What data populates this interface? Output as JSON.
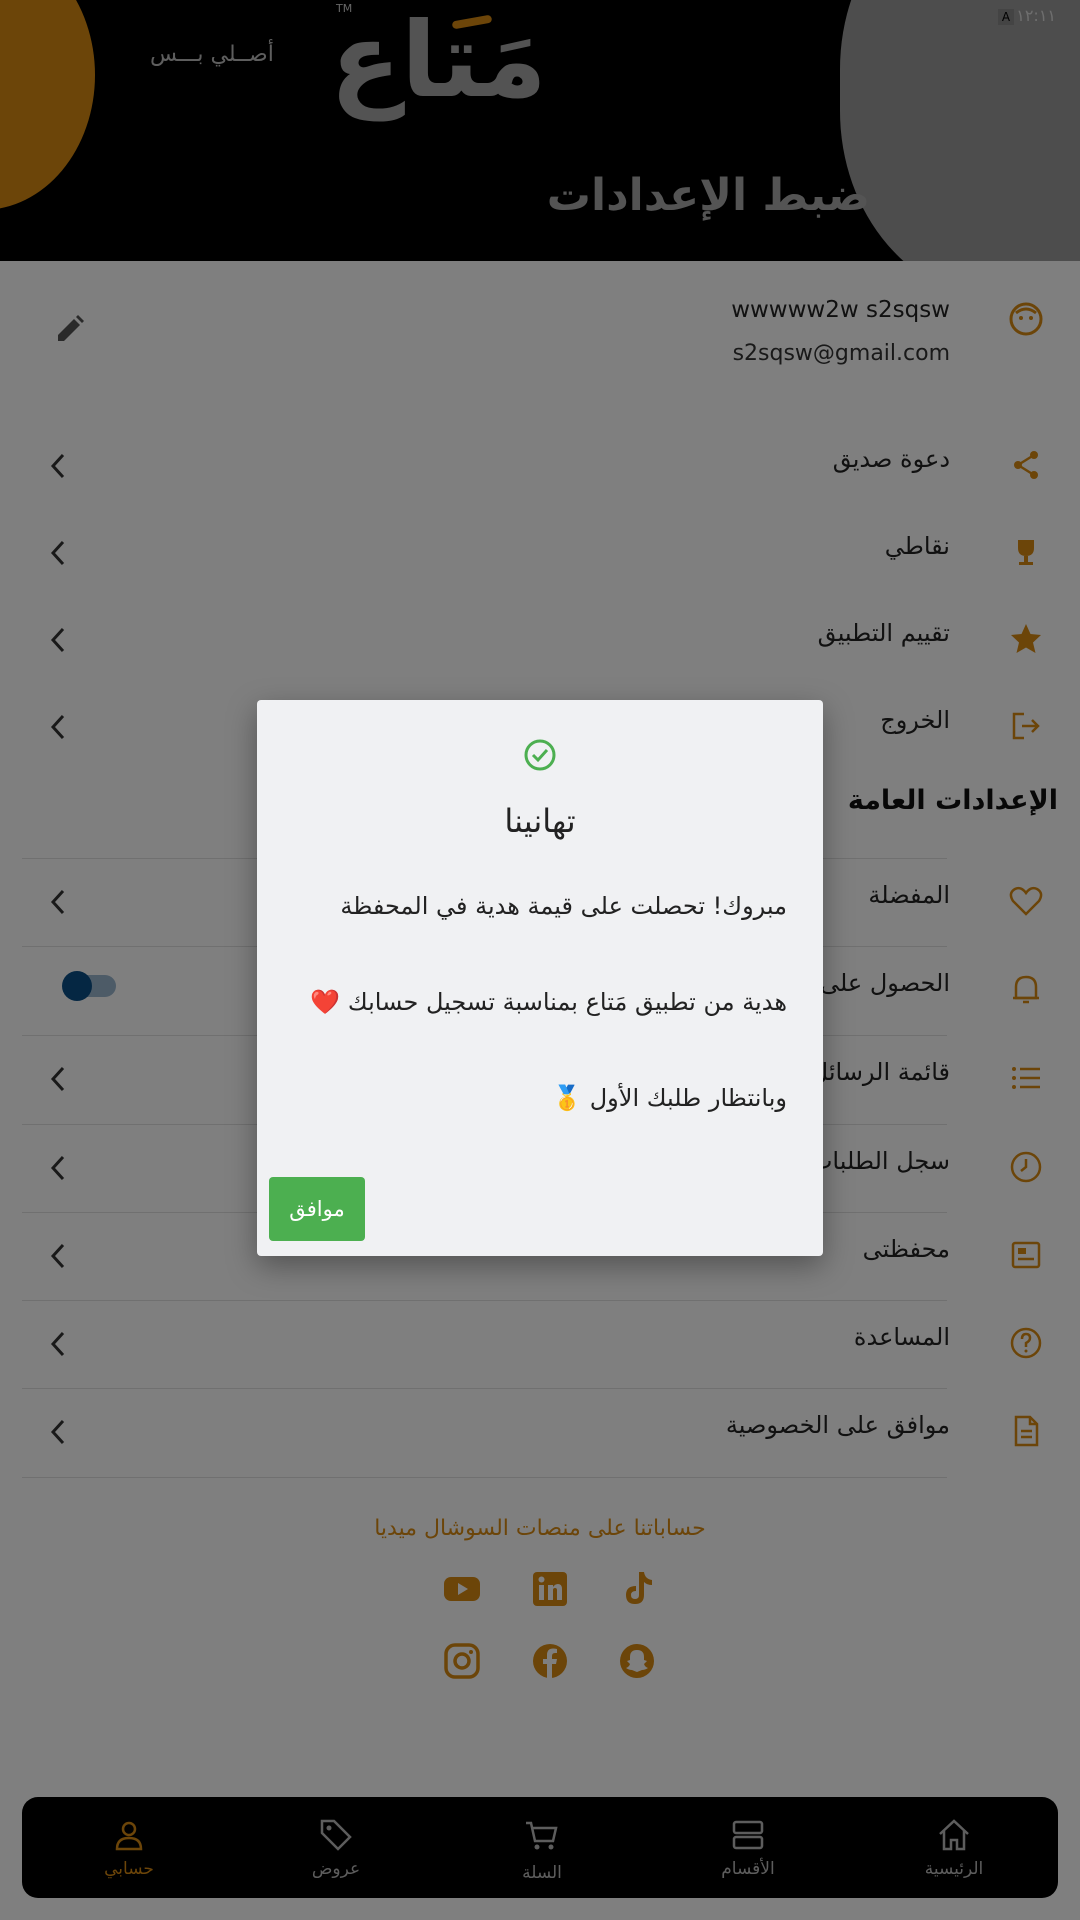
{
  "status_bar": {
    "time": "١٢:١١",
    "indicator": "A"
  },
  "header": {
    "logo_text": "مَتاع",
    "logo_tm": "TM",
    "tagline": "أصــلي بـــس",
    "title": "ضبط الإعدادات"
  },
  "profile": {
    "name": "wwwww2w s2sqsw",
    "email": "s2sqsw@gmail.com"
  },
  "account_items": [
    {
      "label": "دعوة صديق",
      "icon": "share-icon"
    },
    {
      "label": "نقاطي",
      "icon": "trophy-icon"
    },
    {
      "label": "تقييم التطبيق",
      "icon": "star-icon"
    },
    {
      "label": "الخروج",
      "icon": "logout-icon"
    }
  ],
  "general_section": {
    "title": "الإعدادات العامة",
    "items": [
      {
        "label": "المفضلة",
        "icon": "heart-icon"
      },
      {
        "label": "الحصول على",
        "icon": "bell-icon"
      },
      {
        "label": "قائمة الرسائل",
        "icon": "list-icon"
      },
      {
        "label": "سجل الطلبات",
        "icon": "clock-icon"
      },
      {
        "label": "محفظتى",
        "icon": "wallet-icon"
      },
      {
        "label": "المساعدة",
        "icon": "help-icon"
      },
      {
        "label": "موافق على الخصوصية",
        "icon": "document-icon"
      }
    ]
  },
  "social": {
    "title": "حساباتنا على منصات السوشال ميديا",
    "icons": [
      "youtube-icon",
      "linkedin-icon",
      "tiktok-icon",
      "instagram-icon",
      "facebook-icon",
      "snapchat-icon"
    ]
  },
  "bottom_nav": {
    "items": [
      {
        "label": "حسابي",
        "icon": "user-icon",
        "active": true
      },
      {
        "label": "عروض",
        "icon": "tag-icon",
        "active": false
      },
      {
        "label": "السلة",
        "icon": "cart-icon",
        "active": false
      },
      {
        "label": "الأقسام",
        "icon": "categories-icon",
        "active": false
      },
      {
        "label": "الرئيسية",
        "icon": "home-icon",
        "active": false
      }
    ]
  },
  "dialog": {
    "title": "تهانينا",
    "line1": "مبروك! تحصلت على قيمة هدية في المحفظة",
    "line2": "هدية من تطبيق مَتاع بمناسبة تسجيل حسابك ❤️",
    "line3": "وبانتظار طلبك الأول 🥇",
    "ok_label": "موافق"
  },
  "colors": {
    "accent": "#d98b13",
    "success": "#4caf50",
    "toggle": "#0a4e86"
  }
}
